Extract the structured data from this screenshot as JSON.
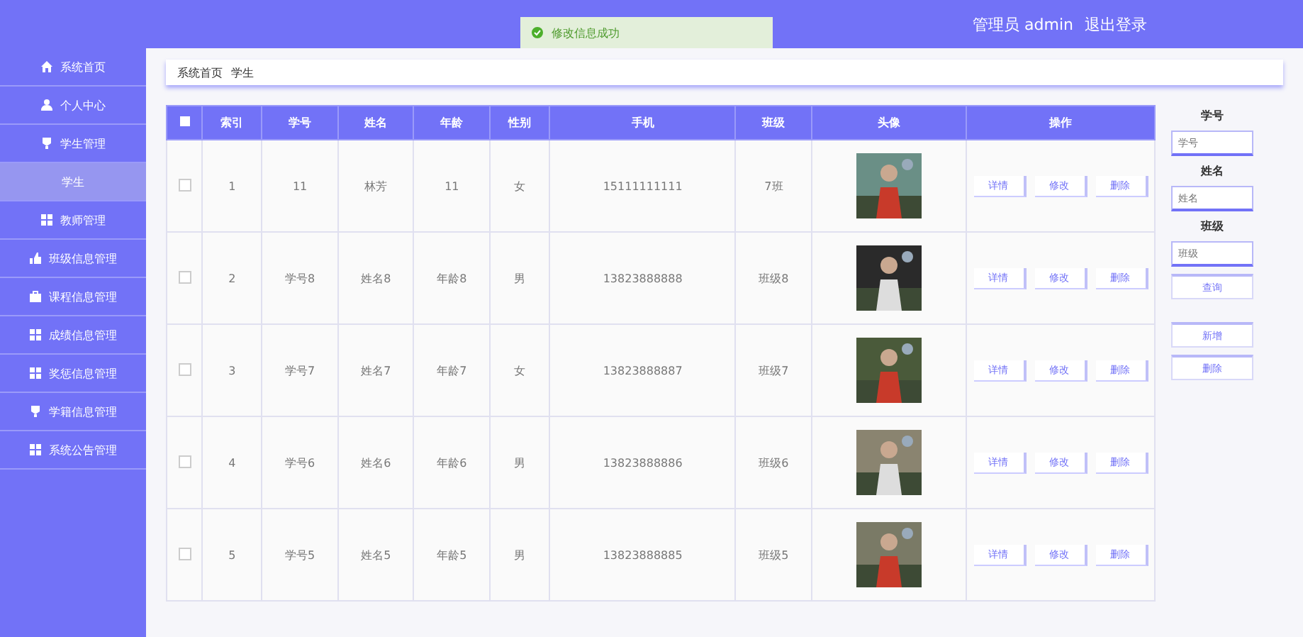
{
  "header": {
    "user": "管理员 admin",
    "logout": "退出登录"
  },
  "toast": {
    "message": "修改信息成功"
  },
  "sidebar": {
    "items": [
      {
        "label": "系统首页",
        "selected": false
      },
      {
        "label": "个人中心",
        "selected": false
      },
      {
        "label": "学生管理",
        "selected": false,
        "children": [
          {
            "label": "学生",
            "selected": true
          }
        ]
      },
      {
        "label": "教师管理",
        "selected": false
      },
      {
        "label": "班级信息管理",
        "selected": false
      },
      {
        "label": "课程信息管理",
        "selected": false
      },
      {
        "label": "成绩信息管理",
        "selected": false
      },
      {
        "label": "奖惩信息管理",
        "selected": false
      },
      {
        "label": "学籍信息管理",
        "selected": false
      },
      {
        "label": "系统公告管理",
        "selected": false
      }
    ]
  },
  "breadcrumb": [
    "系统首页",
    "学生"
  ],
  "table": {
    "select_all_checked": false,
    "columns": [
      "索引",
      "学号",
      "姓名",
      "年龄",
      "性别",
      "手机",
      "班级",
      "头像",
      "操作"
    ],
    "rows": [
      {
        "checked": false,
        "cells": [
          "1",
          "11",
          "林芳",
          "11",
          "女",
          "15111111111",
          "7班"
        ],
        "actions": [
          "详情",
          "修改",
          "删除"
        ]
      },
      {
        "checked": false,
        "cells": [
          "2",
          "学号8",
          "姓名8",
          "年龄8",
          "男",
          "13823888888",
          "班级8"
        ],
        "actions": [
          "详情",
          "修改",
          "删除"
        ]
      },
      {
        "checked": false,
        "cells": [
          "3",
          "学号7",
          "姓名7",
          "年龄7",
          "女",
          "13823888887",
          "班级7"
        ],
        "actions": [
          "详情",
          "修改",
          "删除"
        ]
      },
      {
        "checked": false,
        "cells": [
          "4",
          "学号6",
          "姓名6",
          "年龄6",
          "男",
          "13823888886",
          "班级6"
        ],
        "actions": [
          "详情",
          "修改",
          "删除"
        ]
      },
      {
        "checked": false,
        "cells": [
          "5",
          "学号5",
          "姓名5",
          "年龄5",
          "男",
          "13823888885",
          "班级5"
        ],
        "actions": [
          "详情",
          "修改",
          "删除"
        ]
      }
    ]
  },
  "search": {
    "fields": [
      {
        "label": "学号",
        "placeholder": "学号"
      },
      {
        "label": "姓名",
        "placeholder": "姓名"
      },
      {
        "label": "班级",
        "placeholder": "班级"
      }
    ],
    "button": "查询",
    "add": "新增",
    "delete": "删除"
  }
}
